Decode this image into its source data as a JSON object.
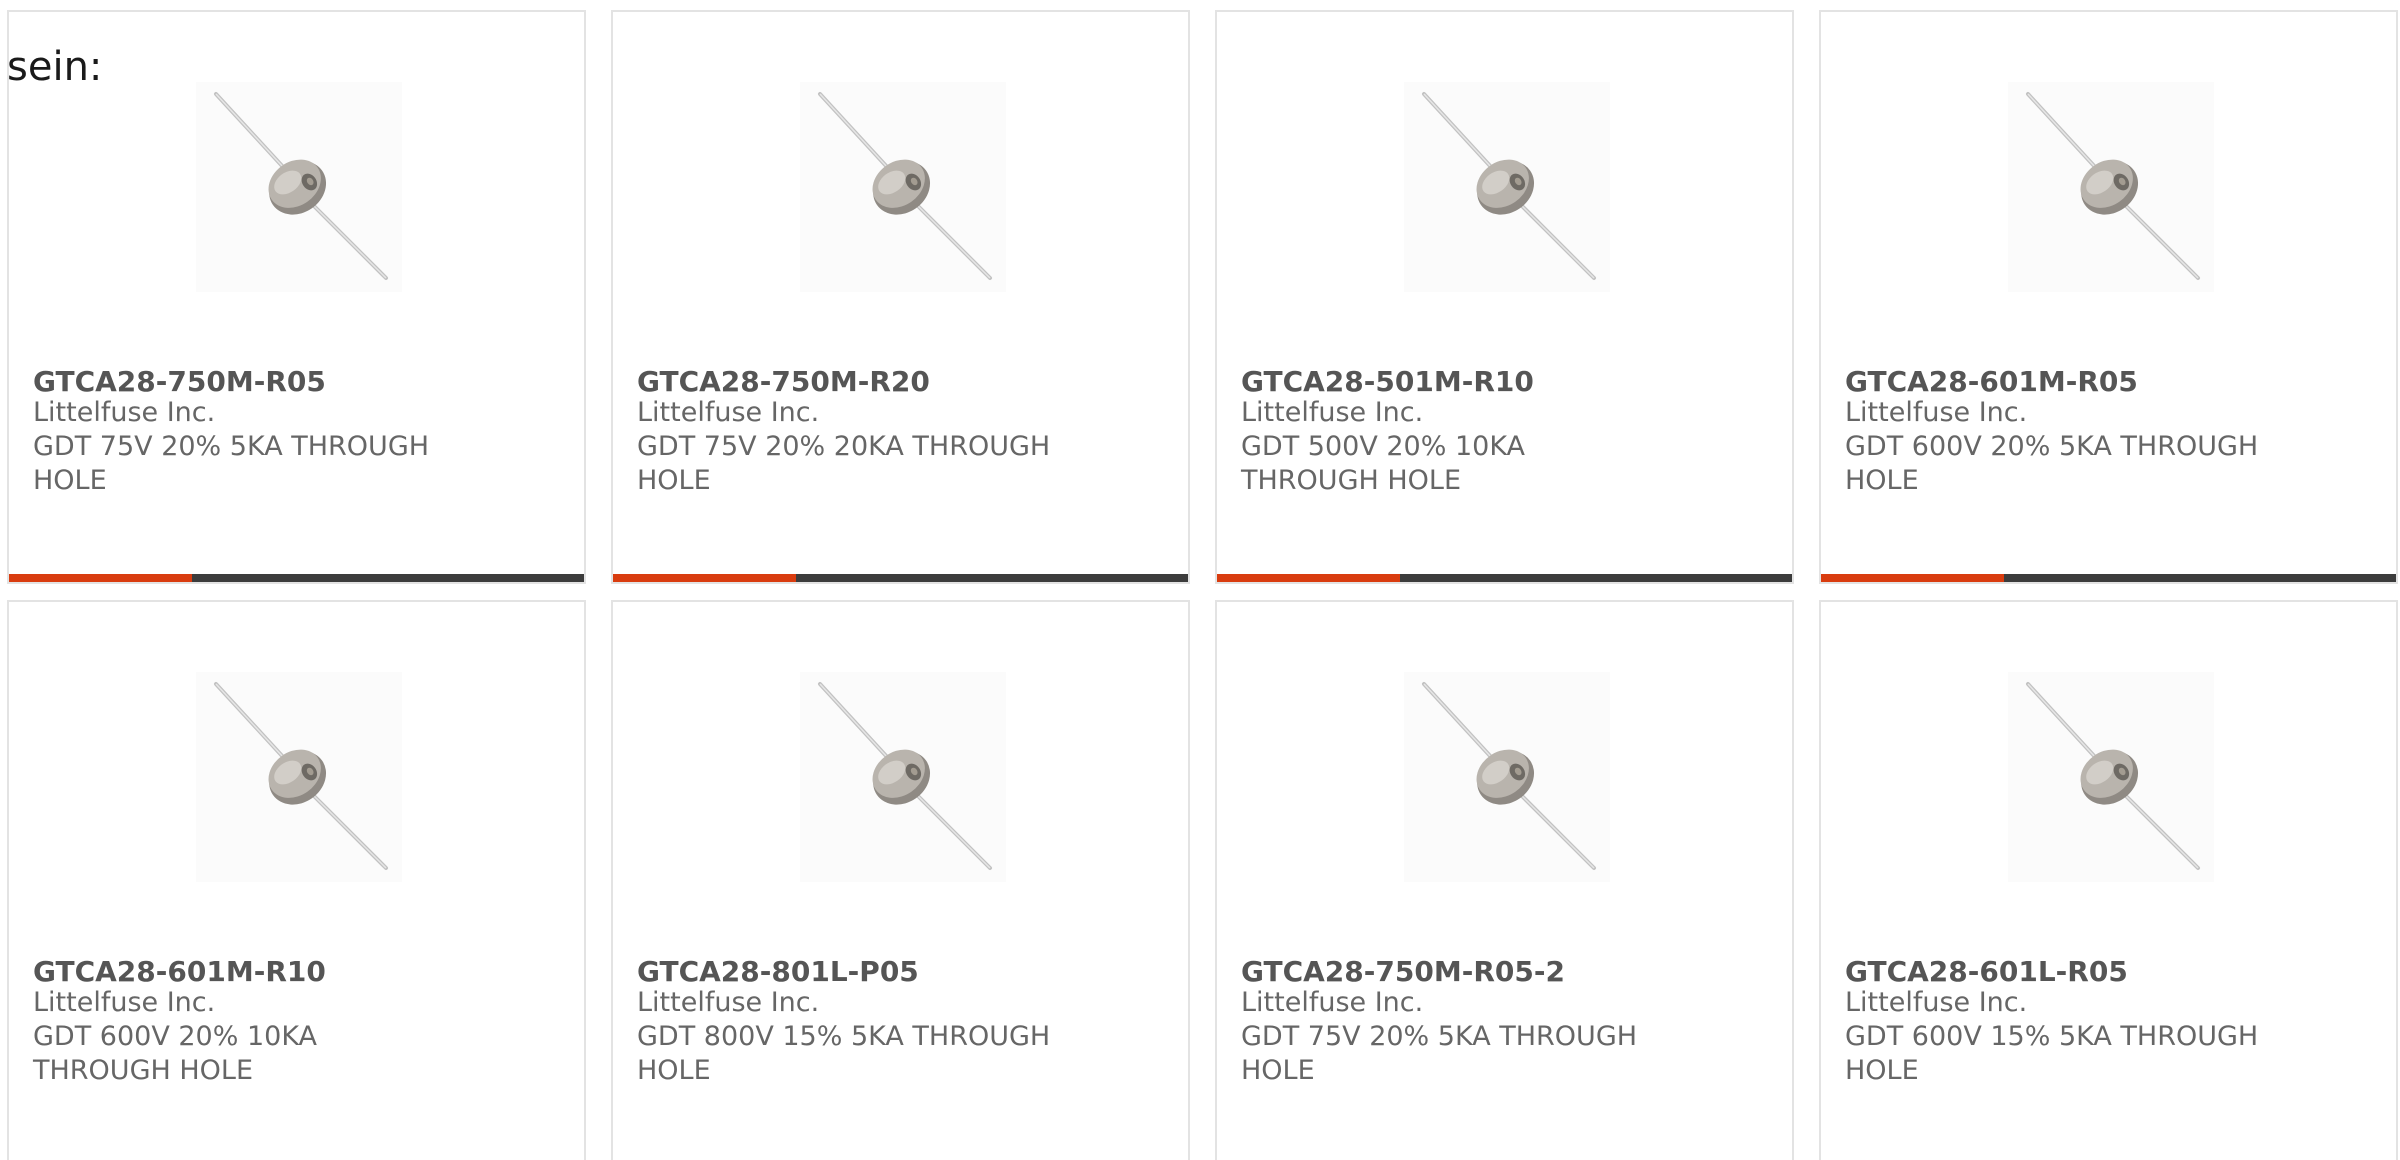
{
  "heading": "sein:",
  "products": [
    {
      "part": "GTCA28-750M-R05",
      "manufacturer": "Littelfuse Inc.",
      "description": "GDT 75V 20% 5KA THROUGH HOLE"
    },
    {
      "part": "GTCA28-750M-R20",
      "manufacturer": "Littelfuse Inc.",
      "description": "GDT 75V 20% 20KA THROUGH HOLE"
    },
    {
      "part": "GTCA28-501M-R10",
      "manufacturer": "Littelfuse Inc.",
      "description": "GDT 500V 20% 10KA THROUGH HOLE"
    },
    {
      "part": "GTCA28-601M-R05",
      "manufacturer": "Littelfuse Inc.",
      "description": "GDT 600V 20% 5KA THROUGH HOLE"
    },
    {
      "part": "GTCA28-601M-R10",
      "manufacturer": "Littelfuse Inc.",
      "description": "GDT 600V 20% 10KA THROUGH HOLE"
    },
    {
      "part": "GTCA28-801L-P05",
      "manufacturer": "Littelfuse Inc.",
      "description": "GDT 800V 15% 5KA THROUGH HOLE"
    },
    {
      "part": "GTCA28-750M-R05-2",
      "manufacturer": "Littelfuse Inc.",
      "description": "GDT 75V 20% 5KA THROUGH HOLE"
    },
    {
      "part": "GTCA28-601L-R05",
      "manufacturer": "Littelfuse Inc.",
      "description": "GDT 600V 15% 5KA THROUGH HOLE"
    }
  ],
  "colors": {
    "accent_bar": "#d93c0f",
    "dark_bar": "#3c3c3c",
    "card_border": "#e3e3e3"
  },
  "icons": {
    "product_image": "gas-discharge-tube-icon"
  }
}
